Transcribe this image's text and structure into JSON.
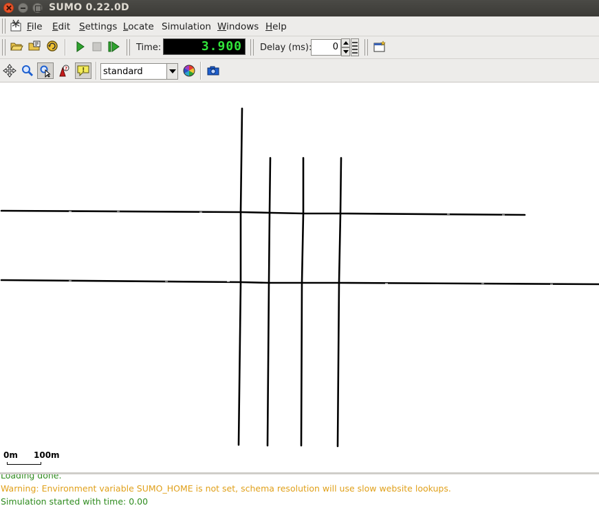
{
  "window": {
    "title": "SUMO 0.22.0D"
  },
  "menubar": {
    "items": [
      {
        "label": "File",
        "underline": "F",
        "rest": "ile"
      },
      {
        "label": "Edit",
        "underline": "E",
        "rest": "dit"
      },
      {
        "label": "Settings",
        "underline": "S",
        "rest": "ettings"
      },
      {
        "label": "Locate",
        "underline": "L",
        "rest": "ocate"
      },
      {
        "label": "Simulation",
        "underline": "",
        "rest": "Simulation"
      },
      {
        "label": "Windows",
        "underline": "W",
        "rest": "indows"
      },
      {
        "label": "Help",
        "underline": "H",
        "rest": "elp"
      }
    ]
  },
  "toolbar": {
    "time_label": "Time:",
    "time_value": "3.900",
    "delay_label": "Delay (ms):",
    "delay_value": "0"
  },
  "viewbar": {
    "scheme_value": "standard"
  },
  "scale": {
    "start": "0m",
    "end": "100m"
  },
  "log": {
    "lines": [
      {
        "text": "Loading done.",
        "color": "#2e8b1e"
      },
      {
        "text": "Warning: Environment variable SUMO_HOME is not set, schema resolution will use slow website lookups.",
        "color": "#e0a01a"
      },
      {
        "text": "Simulation started with time: 0.00",
        "color": "#2e8b1e"
      }
    ]
  },
  "colors": {
    "lcd_text": "#31e53a",
    "play_green": "#2fa32f",
    "road": "#000000"
  }
}
